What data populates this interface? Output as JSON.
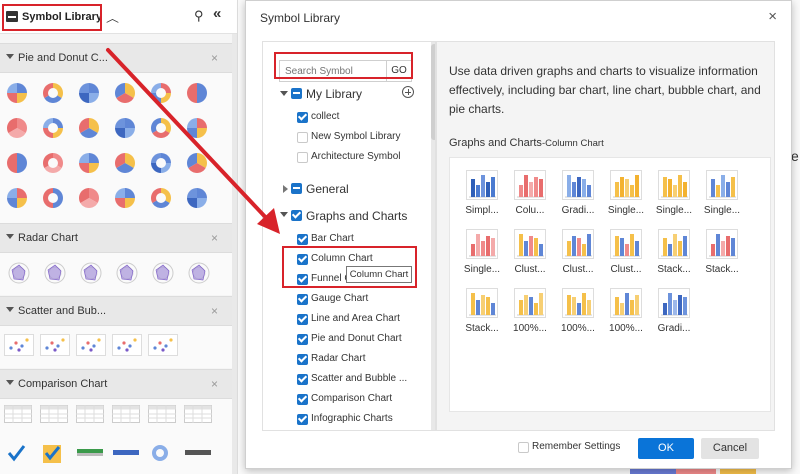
{
  "left_panel": {
    "title": "Symbol Library",
    "sections": [
      {
        "title": "Pie and Donut C...",
        "close": "×"
      },
      {
        "title": "Radar Chart",
        "close": "×"
      },
      {
        "title": "Scatter and Bub...",
        "close": "×"
      },
      {
        "title": "Comparison Chart",
        "close": "×"
      }
    ]
  },
  "dialog": {
    "title": "Symbol Library",
    "close": "×",
    "search": {
      "placeholder": "Search Symbol",
      "go": "GO"
    },
    "my_library": {
      "label": "My Library",
      "add": "+",
      "items": [
        {
          "label": "collect",
          "checked": true
        },
        {
          "label": "New Symbol Library",
          "checked": false
        },
        {
          "label": "Architecture Symbol",
          "checked": false
        }
      ]
    },
    "general": {
      "label": "General"
    },
    "graphs": {
      "label": "Graphs and Charts",
      "items": [
        {
          "label": "Bar Chart"
        },
        {
          "label": "Column Chart"
        },
        {
          "label": "Funnel C"
        },
        {
          "label": "Gauge Chart"
        },
        {
          "label": "Line and Area Chart"
        },
        {
          "label": "Pie and Donut Chart"
        },
        {
          "label": "Radar Chart"
        },
        {
          "label": "Scatter and Bubble ..."
        },
        {
          "label": "Comparison Chart"
        },
        {
          "label": "Infographic Charts"
        }
      ]
    },
    "tooltip": "Column Chart",
    "description": "Use data driven graphs and charts to visualize information effectively, including bar chart, line chart, bubble chart, and pie charts.",
    "section_title": "Graphs and Charts",
    "section_sub": "-Column Chart",
    "symbols": [
      {
        "label": "Simpl...",
        "kind": "simple"
      },
      {
        "label": "Colu...",
        "kind": "pink"
      },
      {
        "label": "Gradi...",
        "kind": "gradient"
      },
      {
        "label": "Single...",
        "kind": "yellow"
      },
      {
        "label": "Single...",
        "kind": "yellow"
      },
      {
        "label": "Single...",
        "kind": "mixed"
      },
      {
        "label": "Single...",
        "kind": "pink2"
      },
      {
        "label": "Clust...",
        "kind": "cluster"
      },
      {
        "label": "Clust...",
        "kind": "cluster"
      },
      {
        "label": "Clust...",
        "kind": "cluster"
      },
      {
        "label": "Stack...",
        "kind": "stack"
      },
      {
        "label": "Stack...",
        "kind": "stackpink"
      },
      {
        "label": "Stack...",
        "kind": "stack"
      },
      {
        "label": "100%...",
        "kind": "hundred"
      },
      {
        "label": "100%...",
        "kind": "hundred"
      },
      {
        "label": "100%...",
        "kind": "hundred"
      },
      {
        "label": "Gradi...",
        "kind": "gradone"
      }
    ],
    "remember": "Remember Settings",
    "ok": "OK",
    "cancel": "Cancel"
  },
  "colors": {
    "accent": "#1a73c9",
    "highlight": "#d8232a",
    "ok_button": "#0a74d8"
  }
}
